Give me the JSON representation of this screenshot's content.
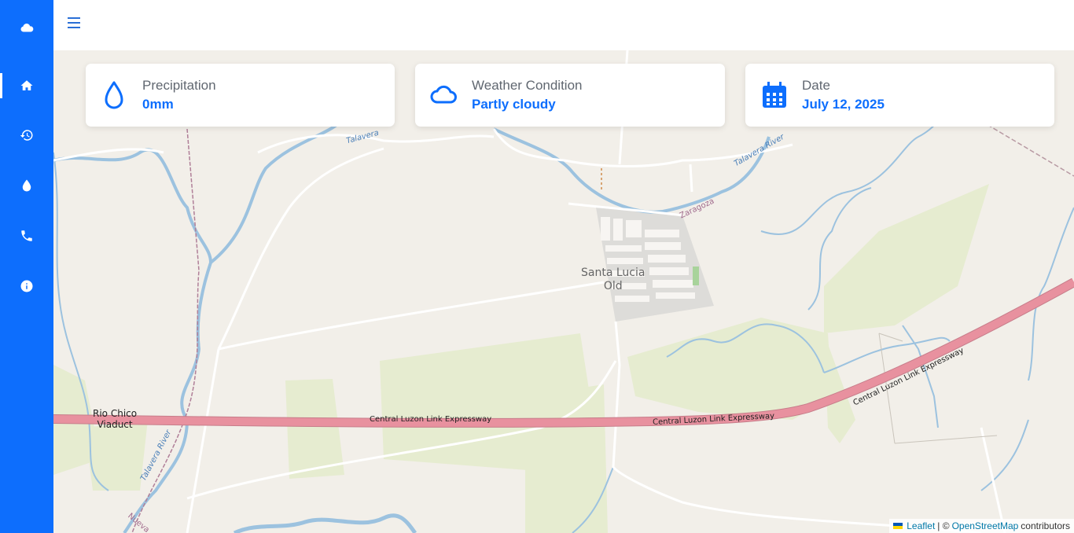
{
  "sidebar": {
    "items": [
      {
        "icon": "cloud-icon",
        "active": false
      },
      {
        "icon": "home-icon",
        "active": true
      },
      {
        "icon": "history-icon",
        "active": false
      },
      {
        "icon": "water-drop-icon",
        "active": false
      },
      {
        "icon": "phone-icon",
        "active": false
      },
      {
        "icon": "info-icon",
        "active": false
      }
    ]
  },
  "cards": {
    "precipitation": {
      "label": "Precipitation",
      "value": "0mm",
      "icon": "water-drop-icon"
    },
    "weather": {
      "label": "Weather Condition",
      "value": "Partly cloudy",
      "icon": "cloud-icon"
    },
    "date": {
      "label": "Date",
      "value": "July 12, 2025",
      "icon": "calendar-icon"
    }
  },
  "map": {
    "labels": {
      "town": "Santa Lucia Old",
      "town_line1": "Santa Lucia",
      "town_line2": "Old",
      "zaragoza": "Zaragoza",
      "river_top": "Talavera",
      "river_right": "Talavera River",
      "river_left": "Talavera River",
      "viaduct_line1": "Rio Chico",
      "viaduct_line2": "Viaduct",
      "expressway1": "Central Luzon Link Expressway",
      "expressway2": "Central Luzon Link Expressway",
      "expressway3": "Central Luzon Link Expressway",
      "nueva": "Nueva"
    },
    "attribution": {
      "leaflet": "Leaflet",
      "separator": "| ©",
      "osm": "OpenStreetMap",
      "contributors": "contributors"
    }
  },
  "colors": {
    "accent": "#0d6efd",
    "expressway": "#e8919f",
    "water": "#9cc2df",
    "park": "#e4ebcf"
  }
}
